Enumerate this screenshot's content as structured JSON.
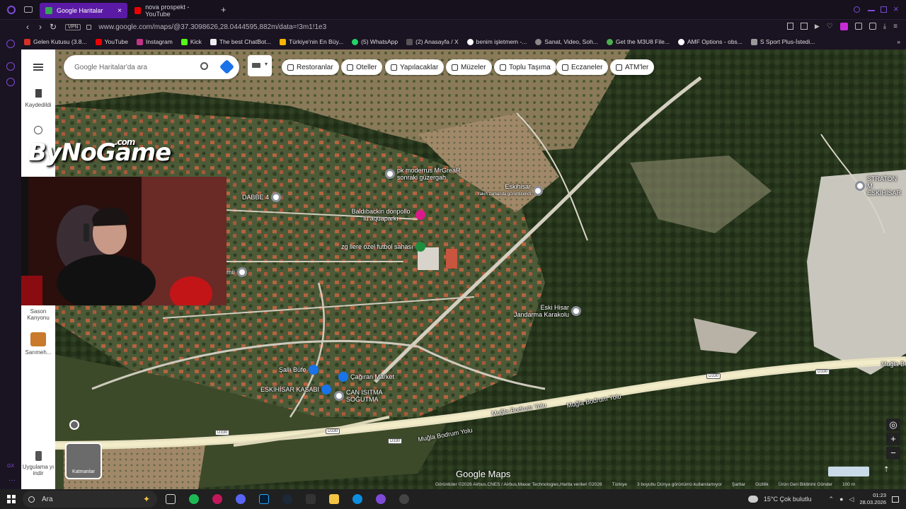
{
  "browser": {
    "tabs": [
      {
        "title": "Google Haritalar",
        "active": true
      },
      {
        "title": "nova prospekt - YouTube",
        "active": false
      }
    ],
    "new_tab": "+",
    "url": "www.google.com/maps/@37.3098626,28.0444595,882m/data=!3m1!1e3",
    "vpn": "VPN",
    "bookmarks": [
      "Gelen Kutusu (3.8...",
      "YouTube",
      "Instagram",
      "Kick",
      "The best ChatBot...",
      "Türkiye'nin En Büy...",
      "(5) WhatsApp",
      "(2) Anasayfa / X",
      "benim işletmem -...",
      "Sanat, Video, Soh...",
      "Get the M3U8 File...",
      "AMF Options - obs...",
      "S Sport Plus-İstedi..."
    ]
  },
  "maps": {
    "sidebar": {
      "menu_icon": "menu-icon",
      "saved": "Kaydedildi",
      "recent_icon": "history-icon",
      "recent_1": "Sason Kanyonu",
      "recent_2": "Sarımeh...",
      "app": "Uygulama yı indir"
    },
    "search_placeholder": "Google Haritalar'da ara",
    "chips": [
      "Restoranlar",
      "Oteller",
      "Yapılacaklar",
      "Müzeler",
      "Toplu Taşıma",
      "Eczaneler",
      "ATM'ler"
    ],
    "pois": [
      {
        "name": "pk moderrus MrGreaR sonraki güzergah"
      },
      {
        "name": "Eskihisar",
        "sub": "Yakın zamanda görüntülendi"
      },
      {
        "name": "DABBE 4"
      },
      {
        "name": "Baldıbackin donpollo lu aquaparkı"
      },
      {
        "name": "zg llere özel futbol sahası"
      },
      {
        "name": "mii"
      },
      {
        "name": "Eski Hisar Jandarma Karakolu"
      },
      {
        "name": "Şallı Büfe"
      },
      {
        "name": "Çağıran Market"
      },
      {
        "name": "ESKİHİSAR KASABI"
      },
      {
        "name": "CAN ISITMA SOĞUTMA"
      },
      {
        "name": "STRATON M ESKİHİSAR"
      }
    ],
    "roads": [
      "Muğla Bodrum Yolu",
      "Muğla Bodrum Yolu",
      "Muğla Bodrum Yolu",
      "Muğla Bodrum Yolu",
      "Muğla Bo"
    ],
    "shield": "D330",
    "layers": "Katmanlar",
    "logo": "Google Maps",
    "attribution": [
      "Görüntüler ©2026 Airbus,CNES / Airbus,Maxar Technologies,Harita verileri ©2026",
      "Türkiye",
      "3 boyutlu Dünya görünümü kullanılamıyor",
      "Şartlar",
      "Gizlilik",
      "Ürün Geri Bildirimi Gönder",
      "100 m"
    ]
  },
  "overlay": {
    "logo_main": "ByNoGame",
    "logo_suffix": ".com"
  },
  "taskbar": {
    "search": "Ara",
    "weather": "15°C Çok bulutlu",
    "time": "01:23",
    "date": "28.03.2026"
  }
}
